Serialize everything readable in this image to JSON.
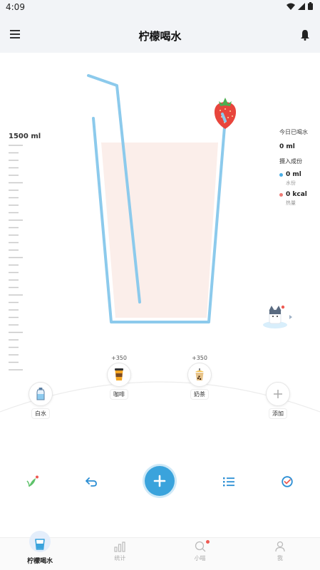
{
  "status_bar": {
    "time": "4:09"
  },
  "header": {
    "title": "柠檬喝水"
  },
  "glass": {
    "scale_label": "1500 ml",
    "fill_fraction": 0.0
  },
  "today": {
    "label": "今日已喝水",
    "value": "0 ml",
    "intake_label": "摄入成份",
    "water": {
      "value": "0 ml",
      "label": "水份",
      "color": "#4aaee6"
    },
    "calories": {
      "value": "0 kcal",
      "label": "热量",
      "color": "#ef7b74"
    }
  },
  "drinks": [
    {
      "label": "白水",
      "extra": ""
    },
    {
      "label": "咖啡",
      "extra": "+350"
    },
    {
      "label": "奶茶",
      "extra": "+350"
    },
    {
      "label": "添加",
      "extra": ""
    }
  ],
  "bottom_nav": [
    {
      "label": "柠檬喝水",
      "icon": "water-cup-icon",
      "active": true
    },
    {
      "label": "统计",
      "icon": "bar-chart-icon",
      "active": false
    },
    {
      "label": "小喵",
      "icon": "search-icon",
      "active": false
    },
    {
      "label": "我",
      "icon": "person-icon",
      "active": false
    }
  ],
  "colors": {
    "accent": "#3aa3dc",
    "straw": "#8ccaec",
    "liquid": "#fbeeea",
    "strawberry": "#e8453c"
  }
}
